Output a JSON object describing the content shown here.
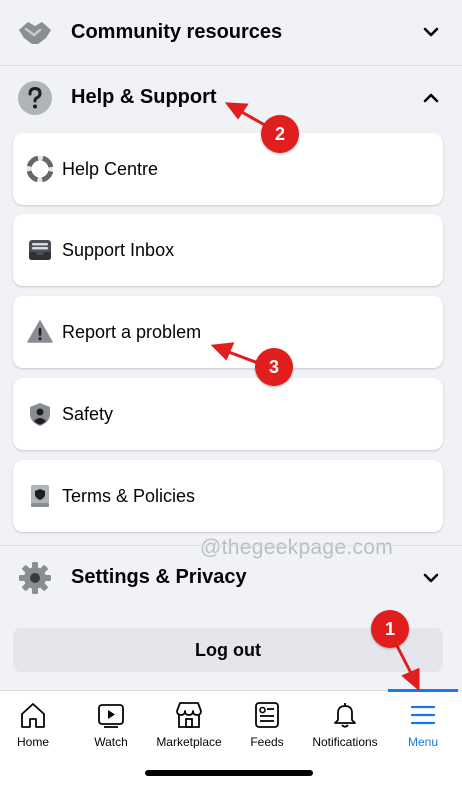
{
  "sections": {
    "community": {
      "label": "Community resources",
      "icon": "handshake-icon",
      "chevron": "chevron-down-icon"
    },
    "help": {
      "label": "Help & Support",
      "icon": "question-icon",
      "chevron": "chevron-up-icon"
    },
    "settings": {
      "label": "Settings & Privacy",
      "icon": "gear-icon",
      "chevron": "chevron-down-icon"
    }
  },
  "help_items": [
    {
      "label": "Help Centre",
      "icon": "lifebuoy-icon"
    },
    {
      "label": "Support Inbox",
      "icon": "inbox-icon"
    },
    {
      "label": "Report a problem",
      "icon": "warning-icon"
    },
    {
      "label": "Safety",
      "icon": "shield-user-icon"
    },
    {
      "label": "Terms & Policies",
      "icon": "book-shield-icon"
    }
  ],
  "watermark": "@thegeekpage.com",
  "logout_label": "Log out",
  "tabs": [
    {
      "label": "Home",
      "icon": "home-icon",
      "active": false
    },
    {
      "label": "Watch",
      "icon": "watch-icon",
      "active": false
    },
    {
      "label": "Marketplace",
      "icon": "marketplace-icon",
      "active": false
    },
    {
      "label": "Feeds",
      "icon": "feeds-icon",
      "active": false
    },
    {
      "label": "Notifications",
      "icon": "bell-icon",
      "active": false
    },
    {
      "label": "Menu",
      "icon": "menu-icon",
      "active": true
    }
  ],
  "annotations": [
    "1",
    "2",
    "3"
  ],
  "colors": {
    "accent": "#1877f2",
    "annotation": "#e01e1e",
    "background": "#f0f2f5"
  }
}
